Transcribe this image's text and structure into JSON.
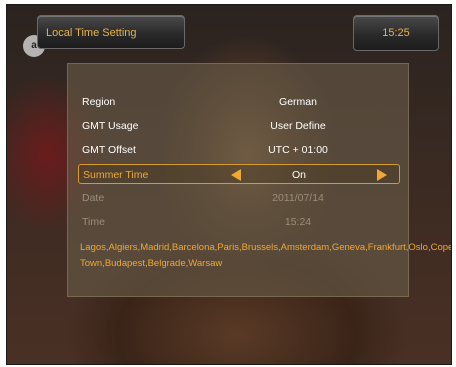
{
  "header": {
    "title": "Local Time Setting",
    "clock": "15:25",
    "brand": "a"
  },
  "settings": {
    "rows": [
      {
        "label": "Region",
        "value": "German",
        "state": "normal"
      },
      {
        "label": "GMT Usage",
        "value": "User Define",
        "state": "normal"
      },
      {
        "label": "GMT Offset",
        "value": "UTC + 01:00",
        "state": "normal"
      },
      {
        "label": "Summer Time",
        "value": "On",
        "state": "selected"
      },
      {
        "label": "Date",
        "value": "2011/07/14",
        "state": "disabled"
      },
      {
        "label": "Time",
        "value": "15:24",
        "state": "disabled"
      }
    ]
  },
  "city_list": "Lagos,Algiers,Madrid,Barcelona,Paris,Brussels,Amsterdam,Geneva,Frankfurt,Oslo,Copenhagen,Rome,Berlin,Prague,Zagreb,Vienna,Stockholm,Cape Town,Budapest,Belgrade,Warsaw",
  "icons": {
    "left": "arrow-left-icon",
    "right": "arrow-right-icon"
  },
  "colors": {
    "accent": "#f0a830",
    "highlight_border": "#d89a2a",
    "text": "#ffffff",
    "disabled_text": "#9c8e78"
  }
}
